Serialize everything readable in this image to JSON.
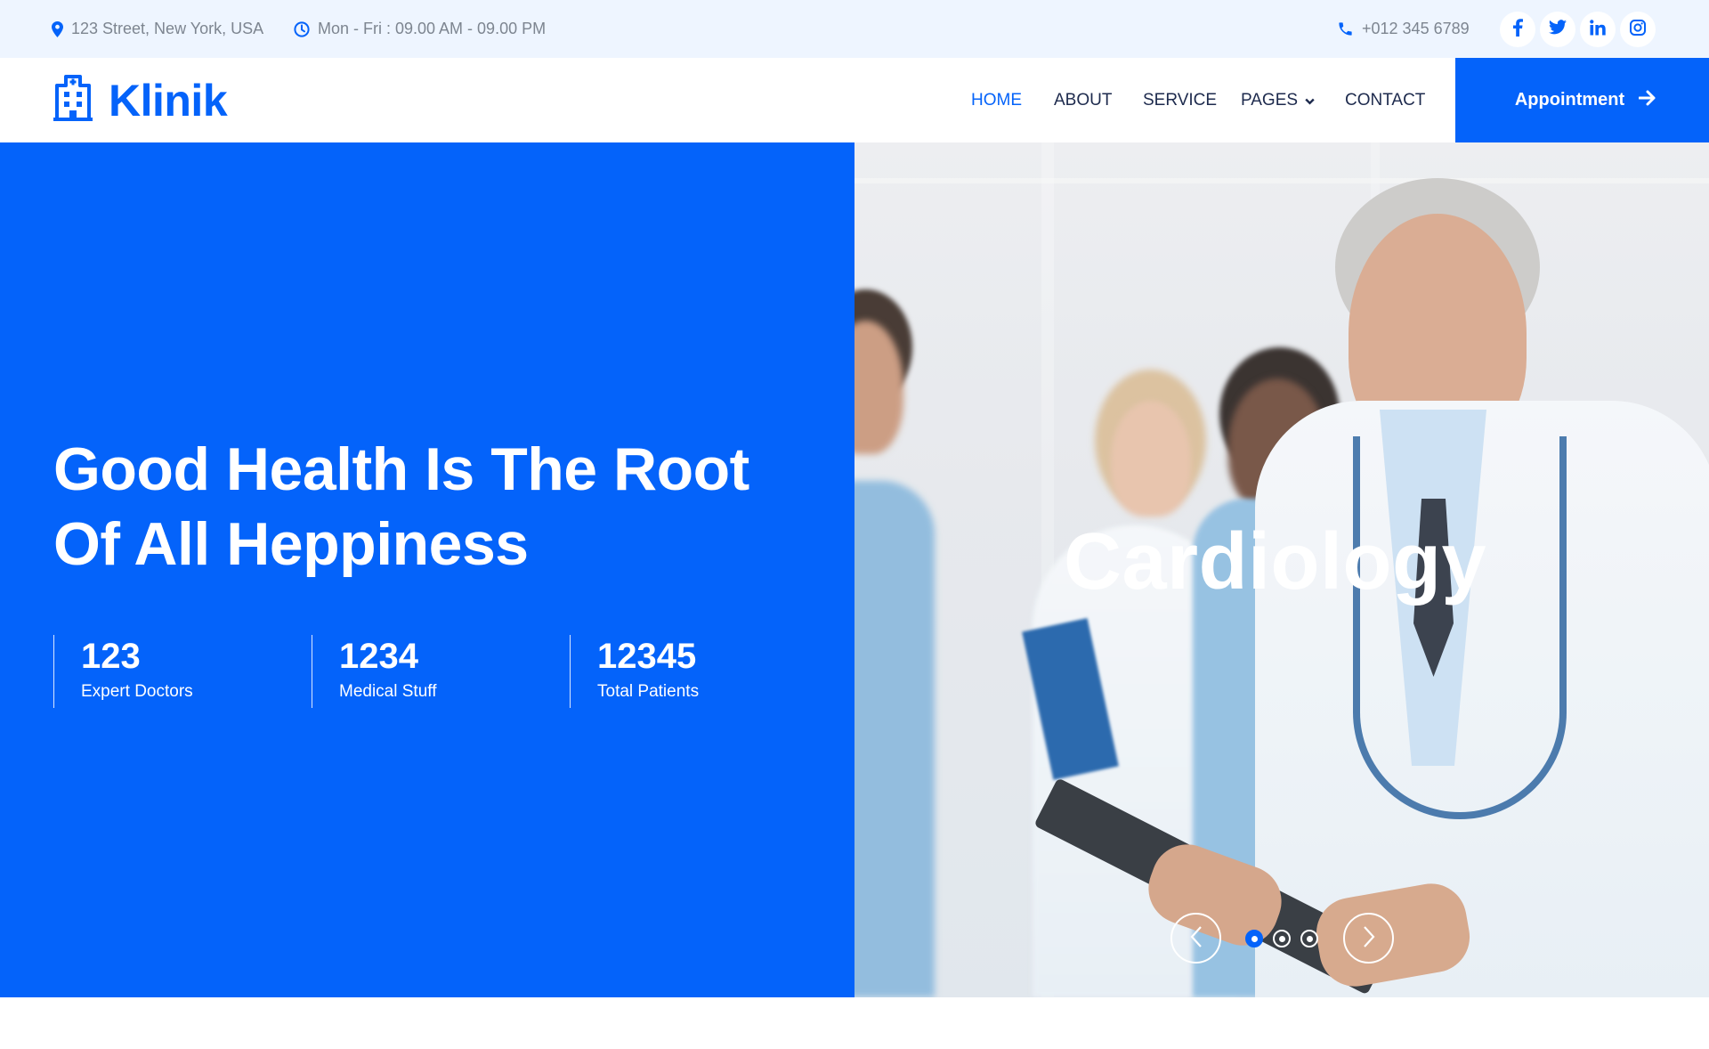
{
  "topbar": {
    "address": "123 Street, New York, USA",
    "hours": "Mon - Fri : 09.00 AM - 09.00 PM",
    "phone": "+012 345 6789",
    "socials": [
      {
        "name": "facebook-icon",
        "glyph": "f"
      },
      {
        "name": "twitter-icon",
        "glyph": "twitter"
      },
      {
        "name": "linkedin-icon",
        "glyph": "in"
      },
      {
        "name": "instagram-icon",
        "glyph": "instagram"
      }
    ]
  },
  "brand": {
    "name": "Klinik",
    "icon": "hospital-icon"
  },
  "nav": {
    "items": [
      {
        "label": "HOME",
        "active": true
      },
      {
        "label": "ABOUT",
        "active": false
      },
      {
        "label": "SERVICE",
        "active": false
      },
      {
        "label": "PAGES",
        "active": false,
        "dropdown": true
      },
      {
        "label": "CONTACT",
        "active": false
      }
    ],
    "cta_label": "Appointment"
  },
  "hero": {
    "title_line1": "Good Health Is The Root",
    "title_line2": "Of All Heppiness",
    "stats": [
      {
        "value": "123",
        "label": "Expert Doctors"
      },
      {
        "value": "1234",
        "label": "Medical Stuff"
      },
      {
        "value": "12345",
        "label": "Total Patients"
      }
    ]
  },
  "carousel": {
    "slide_title": "Cardiology",
    "slide_count": 3,
    "active_slide": 1
  },
  "colors": {
    "primary": "#0463FA",
    "topbar_bg": "#EEF5FF",
    "nav_text": "#1D2A4D",
    "muted_text": "#7D8590"
  }
}
